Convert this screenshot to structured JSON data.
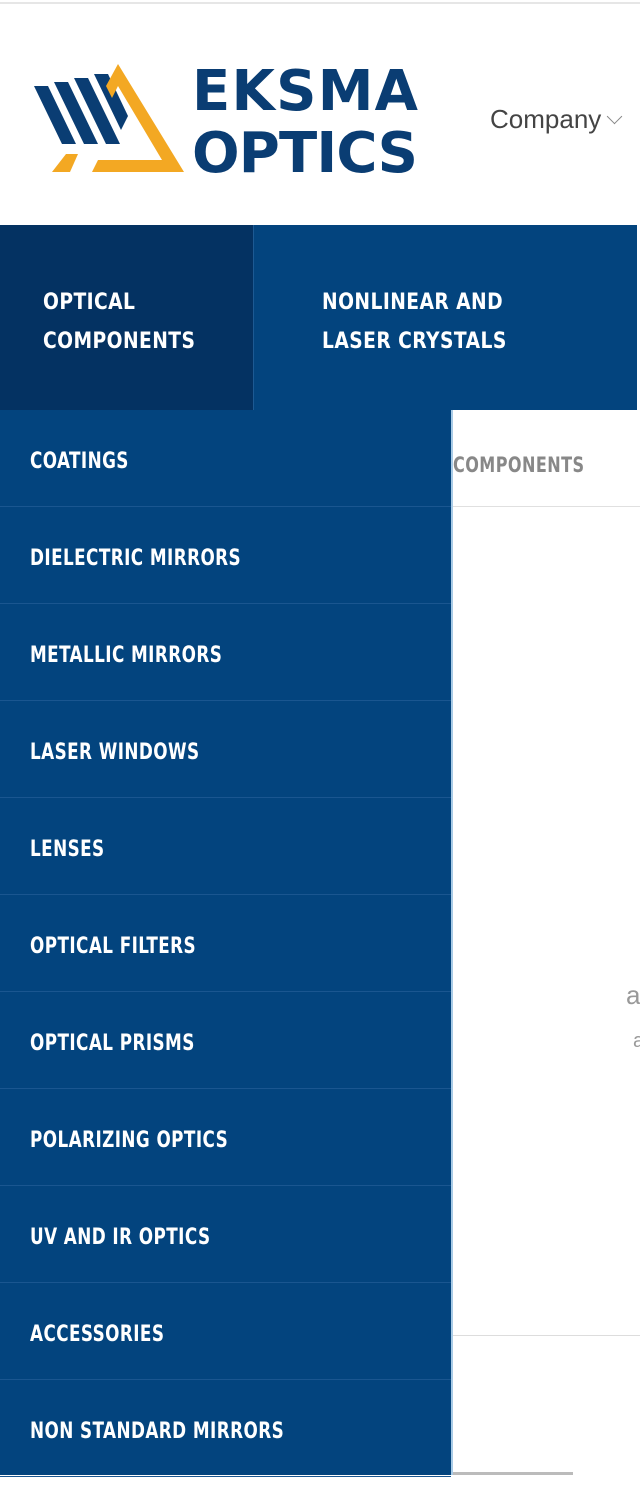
{
  "header": {
    "logo": {
      "line1": "EKSMA",
      "line2": "OPTICS",
      "colors": {
        "blue": "#0a3d73",
        "orange": "#f3a823"
      }
    },
    "top_link": {
      "label": "Company",
      "icon": "chevron-down-icon"
    }
  },
  "nav": {
    "items": [
      {
        "line1": "OPTICAL",
        "line2": "COMPONENTS",
        "active": true
      },
      {
        "line1": "NONLINEAR AND",
        "line2": "LASER CRYSTALS",
        "active": false
      }
    ],
    "colors": {
      "bar": "#03447e",
      "active": "#043262"
    }
  },
  "content": {
    "breadcrumb": "COMPONENTS",
    "fragments": [
      "a",
      "a"
    ]
  },
  "dropdown": {
    "items": [
      "COATINGS",
      "DIELECTRIC MIRRORS",
      "METALLIC MIRRORS",
      "LASER WINDOWS",
      "LENSES",
      "OPTICAL FILTERS",
      "OPTICAL PRISMS",
      "POLARIZING OPTICS",
      "UV AND IR OPTICS",
      "ACCESSORIES",
      "NON STANDARD MIRRORS"
    ]
  }
}
